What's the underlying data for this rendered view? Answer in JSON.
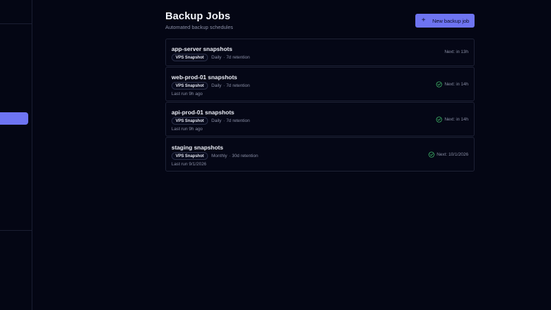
{
  "header": {
    "title": "Backup Jobs",
    "subtitle": "Automated backup schedules",
    "new_button_label": "New backup job"
  },
  "jobs": [
    {
      "name": "app-server snapshots",
      "badge": "VPS Snapshot",
      "frequency": "Daily",
      "retention": "· 7d retention",
      "last_run": "",
      "next": "Next: in 13h",
      "status_ok": false
    },
    {
      "name": "web-prod-01 snapshots",
      "badge": "VPS Snapshot",
      "frequency": "Daily",
      "retention": "· 7d retention",
      "last_run": "Last run 9h ago",
      "next": "Next: in 14h",
      "status_ok": true
    },
    {
      "name": "api-prod-01 snapshots",
      "badge": "VPS Snapshot",
      "frequency": "Daily",
      "retention": "· 7d retention",
      "last_run": "Last run 9h ago",
      "next": "Next: in 14h",
      "status_ok": true
    },
    {
      "name": "staging snapshots",
      "badge": "VPS Snapshot",
      "frequency": "Monthly",
      "retention": "· 30d retention",
      "last_run": "Last run 9/1/2026",
      "next": "Next: 10/1/2026",
      "status_ok": true
    }
  ],
  "colors": {
    "accent": "#6e74f2",
    "success": "#3fb96a",
    "background": "#040614"
  },
  "icons": {
    "plus": "plus-icon",
    "status": "check-circle-icon"
  }
}
